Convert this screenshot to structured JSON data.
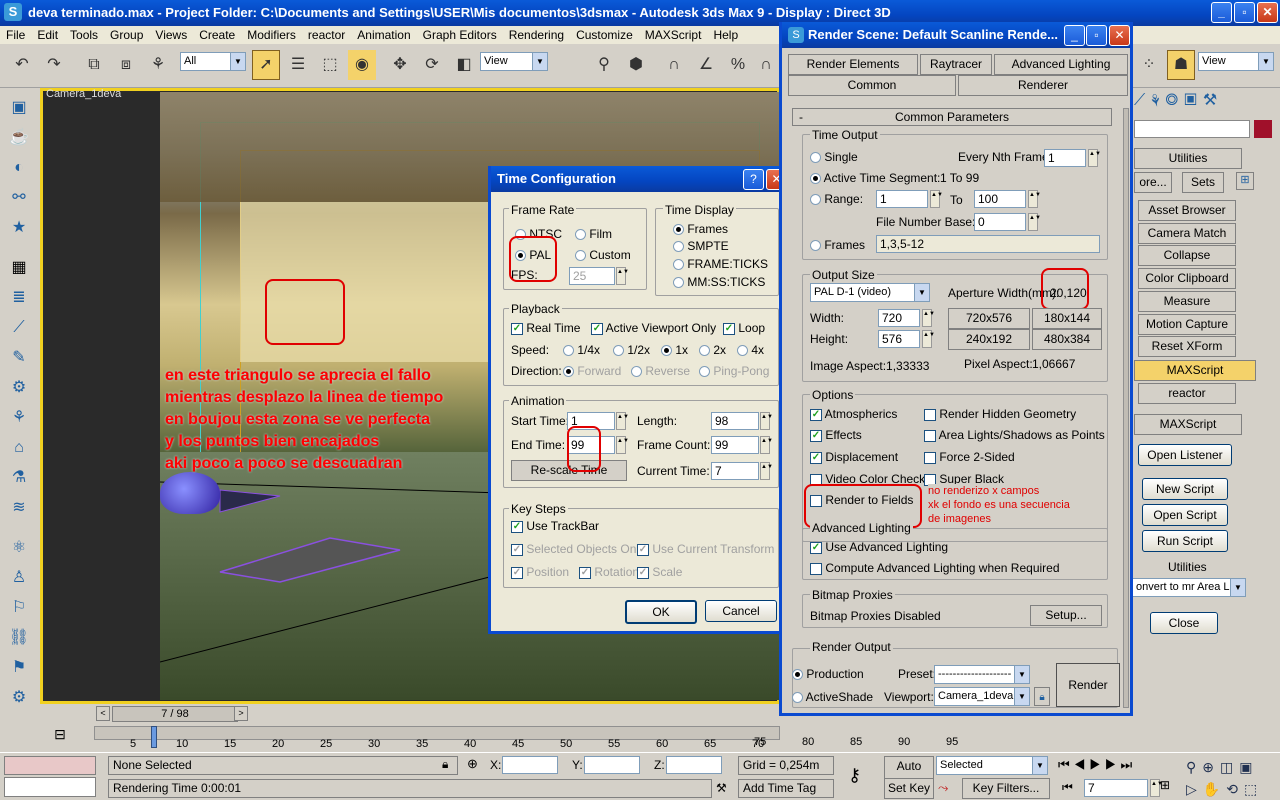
{
  "app": {
    "title": "deva terminado.max      - Project Folder: C:\\Documents and Settings\\USER\\Mis documentos\\3dsmax       - Autodesk 3ds Max 9       - Display : Direct 3D",
    "menu": [
      "File",
      "Edit",
      "Tools",
      "Group",
      "Views",
      "Create",
      "Modifiers",
      "reactor",
      "Animation",
      "Graph Editors",
      "Rendering",
      "Customize",
      "MAXScript",
      "Help"
    ],
    "selection_filter": "All",
    "ref_coord": "View",
    "ref_coord_right": "View"
  },
  "viewport": {
    "label": "Camera_1deva",
    "frame_indicator": "7 / 98"
  },
  "annotations": {
    "lines": [
      "en este triangulo se aprecia el fallo",
      "mientras desplazo la linea de tiempo",
      "en boujou esta zona se ve perfecta",
      " y los puntos bien encajados",
      " aki poco a poco se descuadran"
    ],
    "render_note": [
      "no renderizo x campos",
      " xk el fondo es una secuencia",
      "de imagenes"
    ]
  },
  "time_config": {
    "title": "Time Configuration",
    "frame_rate": {
      "label": "Frame Rate",
      "options": [
        "NTSC",
        "Film",
        "PAL",
        "Custom"
      ],
      "selected": "PAL",
      "fps_label": "FPS:",
      "fps": "25"
    },
    "time_display": {
      "label": "Time Display",
      "options": [
        "Frames",
        "SMPTE",
        "FRAME:TICKS",
        "MM:SS:TICKS"
      ],
      "selected": "Frames"
    },
    "playback": {
      "label": "Playback",
      "real_time": "Real Time",
      "active_viewport": "Active Viewport Only",
      "loop": "Loop",
      "speed_label": "Speed:",
      "speeds": [
        "1/4x",
        "1/2x",
        "1x",
        "2x",
        "4x"
      ],
      "speed_selected": "1x",
      "direction_label": "Direction:",
      "directions": [
        "Forward",
        "Reverse",
        "Ping-Pong"
      ]
    },
    "animation": {
      "label": "Animation",
      "start_label": "Start Time:",
      "start": "1",
      "length_label": "Length:",
      "length": "98",
      "end_label": "End Time:",
      "end": "99",
      "frame_count_label": "Frame Count:",
      "frame_count": "99",
      "rescale": "Re-scale Time",
      "current_label": "Current Time:",
      "current": "7"
    },
    "key_steps": {
      "label": "Key Steps",
      "use_trackbar": "Use TrackBar",
      "selected_only": "Selected Objects Only",
      "use_current": "Use Current Transform",
      "position": "Position",
      "rotation": "Rotation",
      "scale": "Scale"
    },
    "ok": "OK",
    "cancel": "Cancel"
  },
  "render_scene": {
    "title": "Render Scene: Default Scanline Rende...",
    "tabs_row1": [
      "Render Elements",
      "Raytracer",
      "Advanced Lighting"
    ],
    "tabs_row2": [
      "Common",
      "Renderer"
    ],
    "rollout": "Common Parameters",
    "time_output": {
      "label": "Time Output",
      "single": "Single",
      "every_nth": "Every Nth Frame:",
      "every_nth_val": "1",
      "active_segment": "Active Time Segment:",
      "active_range": "1 To 99",
      "range": "Range:",
      "range_from": "1",
      "to": "To",
      "range_to": "100",
      "file_base": "File Number Base:",
      "file_base_val": "0",
      "frames": "Frames",
      "frames_val": "1,3,5-12"
    },
    "output_size": {
      "label": "Output Size",
      "preset": "PAL D-1 (video)",
      "aperture_label": "Aperture Width(mm):",
      "aperture": "20,120",
      "width_label": "Width:",
      "width": "720",
      "height_label": "Height:",
      "height": "576",
      "presets": [
        "720x576",
        "180x144",
        "240x192",
        "480x384"
      ],
      "image_aspect": "Image Aspect:1,33333",
      "pixel_aspect_label": "Pixel Aspect:",
      "pixel_aspect": "1,06667"
    },
    "options": {
      "label": "Options",
      "atmospherics": "Atmospherics",
      "render_hidden": "Render Hidden Geometry",
      "effects": "Effects",
      "area_lights": "Area Lights/Shadows as Points",
      "displacement": "Displacement",
      "force2": "Force 2-Sided",
      "video_color": "Video Color Check",
      "super_black": "Super Black",
      "render_fields": "Render to Fields"
    },
    "adv_lighting": {
      "label": "Advanced Lighting",
      "use": "Use Advanced Lighting",
      "compute": "Compute Advanced Lighting when Required"
    },
    "bitmap": {
      "label": "Bitmap Proxies",
      "status": "Bitmap Proxies Disabled",
      "setup": "Setup..."
    },
    "render_output": {
      "label": "Render Output",
      "production": "Production",
      "activeshade": "ActiveShade",
      "preset_label": "Preset:",
      "preset": "--------------------",
      "viewport_label": "Viewport:",
      "viewport": "Camera_1deva",
      "render": "Render"
    }
  },
  "right_panel": {
    "utilities": "Utilities",
    "more": "ore...",
    "sets": "Sets",
    "items": [
      "Asset Browser",
      "Camera Match",
      "Collapse",
      "Color Clipboard",
      "Measure",
      "Motion Capture",
      "Reset XForm",
      "MAXScript",
      "reactor"
    ],
    "highlight": "MAXScript",
    "maxscript_title": "MAXScript",
    "open_listener": "Open Listener",
    "new_script": "New Script",
    "open_script": "Open Script",
    "run_script": "Run Script",
    "utilities2": "Utilities",
    "convert": "onvert to mr Area Li",
    "close": "Close"
  },
  "timeline": {
    "ticks": [
      "5",
      "10",
      "15",
      "20",
      "25",
      "30",
      "35",
      "40",
      "45",
      "50",
      "55",
      "60",
      "65",
      "70",
      "75",
      "80",
      "85",
      "90",
      "95"
    ]
  },
  "status": {
    "none_selected": "None Selected",
    "rendering_time": "Rendering Time  0:00:01",
    "x_label": "X:",
    "y_label": "Y:",
    "z_label": "Z:",
    "grid": "Grid = 0,254m",
    "auto_key": "Auto Key",
    "set_key": "Set Key",
    "selected": "Selected",
    "key_filters": "Key Filters...",
    "add_time_tag": "Add Time Tag",
    "frame": "7"
  }
}
